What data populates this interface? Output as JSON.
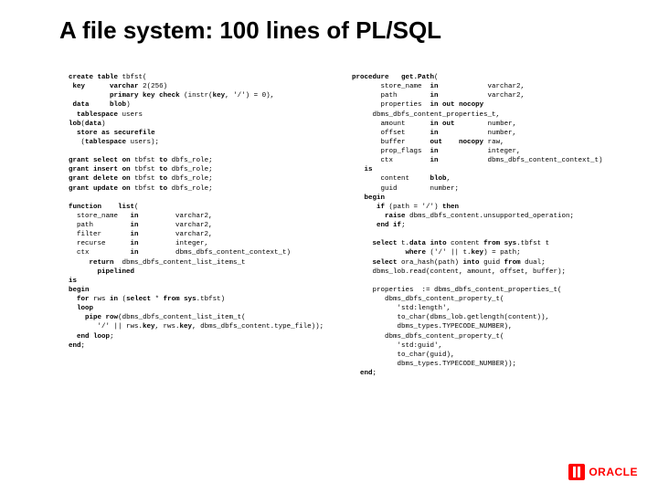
{
  "title": "A file system: 100 lines of PL/SQL",
  "logo": {
    "text": "ORACLE"
  },
  "code": {
    "left": "create table tbfst(\n key      varchar 2(256)\n          primary key check (instr(key, '/') = 0),\n data     blob)\n  tablespace users\nlob(data)\n  store as securefile\n   (tablespace users);\n\ngrant select on tbfst to dbfs_role;\ngrant insert on tbfst to dbfs_role;\ngrant delete on tbfst to dbfs_role;\ngrant update on tbfst to dbfs_role;\n\nfunction    list(\n  store_name   in         varchar2,\n  path         in         varchar2,\n  filter       in         varchar2,\n  recurse      in         integer,\n  ctx          in         dbms_dbfs_content_context_t)\n     return  dbms_dbfs_content_list_items_t\n       pipelined\nis\nbegin\n  for rws in (select * from sys.tbfst)\n  loop\n    pipe row(dbms_dbfs_content_list_item_t(\n       '/' || rws.key, rws.key, dbms_dbfs_content.type_file));\n  end loop;\nend;",
    "right": "procedure   get.Path(\n       store_name  in            varchar2,\n       path        in            varchar2,\n       properties  in out nocopy\n     dbms_dbfs_content_properties_t,\n       amount      in out        number,\n       offset      in            number,\n       buffer      out    nocopy raw,\n       prop_flags  in            integer,\n       ctx         in            dbms_dbfs_content_context_t)\n   is\n       content     blob,\n       guid        number;\n   begin\n      if (path = '/') then\n        raise dbms_dbfs_content.unsupported_operation;\n      end if;\n\n     select t.data into content from sys.tbfst t\n             where ('/' || t.key) = path;\n     select ora_hash(path) into guid from dual;\n     dbms_lob.read(content, amount, offset, buffer);\n\n     properties  := dbms_dbfs_content_properties_t(\n        dbms_dbfs_content_property_t(\n           'std:length',\n           to_char(dbms_lob.getlength(content)),\n           dbms_types.TYPECODE_NUMBER),\n        dbms_dbfs_content_property_t(\n           'std:guid',\n           to_char(guid),\n           dbms_types.TYPECODE_NUMBER));\n  end;"
  }
}
